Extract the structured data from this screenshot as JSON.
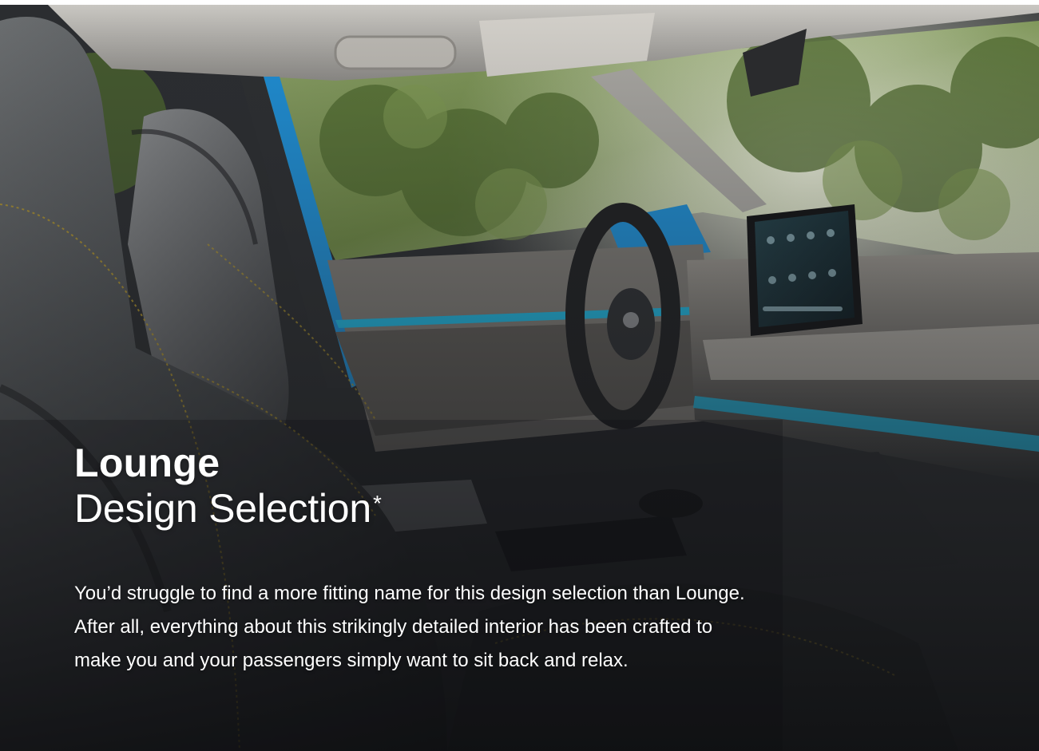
{
  "hero": {
    "image_description_icon": "car-interior-photo",
    "colors": {
      "accent_blue": "#1e8fd6",
      "ambient_light": "#1fb6e0",
      "stitching": "#b89a2a",
      "foliage": "#5f7a3a"
    }
  },
  "heading": {
    "title_bold": "Lounge",
    "title_light": "Design Selection",
    "footnote_mark": "*"
  },
  "body": {
    "paragraph": "You’d struggle to find a more fitting name for this design selection than Lounge. After all, everything about this strikingly detailed interior has been crafted to make you and your passengers simply want to sit back and relax."
  }
}
